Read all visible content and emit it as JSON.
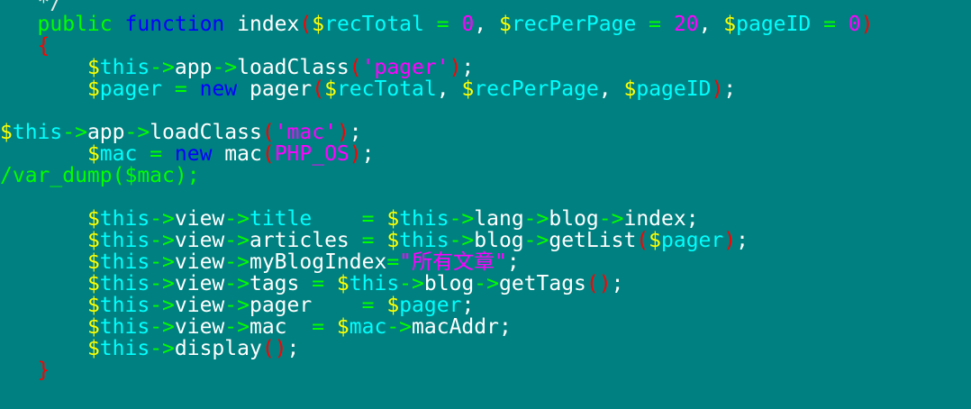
{
  "editor": {
    "background": "#008080",
    "lines": [
      {
        "tokens": [
          {
            "t": "   ",
            "c": "plain"
          },
          {
            "t": "*/",
            "c": "comment"
          }
        ]
      },
      {
        "tokens": [
          {
            "t": "   ",
            "c": "plain"
          },
          {
            "t": "public",
            "c": "keyword"
          },
          {
            "t": " ",
            "c": "plain"
          },
          {
            "t": "function",
            "c": "function"
          },
          {
            "t": " index",
            "c": "ident"
          },
          {
            "t": "(",
            "c": "paren"
          },
          {
            "t": "$",
            "c": "var"
          },
          {
            "t": "recTotal",
            "c": "varname"
          },
          {
            "t": " = ",
            "c": "op"
          },
          {
            "t": "0",
            "c": "number"
          },
          {
            "t": ", ",
            "c": "plain"
          },
          {
            "t": "$",
            "c": "var"
          },
          {
            "t": "recPerPage",
            "c": "varname"
          },
          {
            "t": " = ",
            "c": "op"
          },
          {
            "t": "20",
            "c": "number"
          },
          {
            "t": ", ",
            "c": "plain"
          },
          {
            "t": "$",
            "c": "var"
          },
          {
            "t": "pageID",
            "c": "varname"
          },
          {
            "t": " = ",
            "c": "op"
          },
          {
            "t": "0",
            "c": "number"
          },
          {
            "t": ")",
            "c": "paren"
          }
        ]
      },
      {
        "tokens": [
          {
            "t": "   ",
            "c": "plain"
          },
          {
            "t": "{",
            "c": "brace"
          }
        ]
      },
      {
        "tokens": [
          {
            "t": "       ",
            "c": "plain"
          },
          {
            "t": "$",
            "c": "var"
          },
          {
            "t": "this",
            "c": "varname"
          },
          {
            "t": "->",
            "c": "op"
          },
          {
            "t": "app",
            "c": "ident"
          },
          {
            "t": "->",
            "c": "op"
          },
          {
            "t": "loadClass",
            "c": "ident"
          },
          {
            "t": "(",
            "c": "paren"
          },
          {
            "t": "'pager'",
            "c": "string"
          },
          {
            "t": ")",
            "c": "paren"
          },
          {
            "t": ";",
            "c": "punct"
          }
        ]
      },
      {
        "tokens": [
          {
            "t": "       ",
            "c": "plain"
          },
          {
            "t": "$",
            "c": "var"
          },
          {
            "t": "pager",
            "c": "varname"
          },
          {
            "t": " = ",
            "c": "op"
          },
          {
            "t": "new",
            "c": "new"
          },
          {
            "t": " pager",
            "c": "ident"
          },
          {
            "t": "(",
            "c": "paren"
          },
          {
            "t": "$",
            "c": "var"
          },
          {
            "t": "recTotal",
            "c": "varname"
          },
          {
            "t": ", ",
            "c": "plain"
          },
          {
            "t": "$",
            "c": "var"
          },
          {
            "t": "recPerPage",
            "c": "varname"
          },
          {
            "t": ", ",
            "c": "plain"
          },
          {
            "t": "$",
            "c": "var"
          },
          {
            "t": "pageID",
            "c": "varname"
          },
          {
            "t": ")",
            "c": "paren"
          },
          {
            "t": ";",
            "c": "punct"
          }
        ]
      },
      {
        "tokens": []
      },
      {
        "tokens": [
          {
            "t": "$",
            "c": "var"
          },
          {
            "t": "this",
            "c": "varname"
          },
          {
            "t": "->",
            "c": "op"
          },
          {
            "t": "app",
            "c": "ident"
          },
          {
            "t": "->",
            "c": "op"
          },
          {
            "t": "loadClass",
            "c": "ident"
          },
          {
            "t": "(",
            "c": "paren"
          },
          {
            "t": "'mac'",
            "c": "string"
          },
          {
            "t": ")",
            "c": "paren"
          },
          {
            "t": ";",
            "c": "punct"
          }
        ]
      },
      {
        "tokens": [
          {
            "t": "       ",
            "c": "plain"
          },
          {
            "t": "$",
            "c": "var"
          },
          {
            "t": "mac",
            "c": "varname"
          },
          {
            "t": " = ",
            "c": "op"
          },
          {
            "t": "new",
            "c": "new"
          },
          {
            "t": " mac",
            "c": "ident"
          },
          {
            "t": "(",
            "c": "paren"
          },
          {
            "t": "PHP_OS",
            "c": "const"
          },
          {
            "t": ")",
            "c": "paren"
          },
          {
            "t": ";",
            "c": "punct"
          }
        ]
      },
      {
        "tokens": [
          {
            "t": "/var_dump($mac);",
            "c": "keyword"
          }
        ]
      },
      {
        "tokens": []
      },
      {
        "tokens": [
          {
            "t": "       ",
            "c": "plain"
          },
          {
            "t": "$",
            "c": "var"
          },
          {
            "t": "this",
            "c": "varname"
          },
          {
            "t": "->",
            "c": "op"
          },
          {
            "t": "view",
            "c": "ident"
          },
          {
            "t": "->",
            "c": "op"
          },
          {
            "t": "title",
            "c": "varname"
          },
          {
            "t": "    = ",
            "c": "op"
          },
          {
            "t": "$",
            "c": "var"
          },
          {
            "t": "this",
            "c": "varname"
          },
          {
            "t": "->",
            "c": "op"
          },
          {
            "t": "lang",
            "c": "ident"
          },
          {
            "t": "->",
            "c": "op"
          },
          {
            "t": "blog",
            "c": "ident"
          },
          {
            "t": "->",
            "c": "op"
          },
          {
            "t": "index",
            "c": "ident"
          },
          {
            "t": ";",
            "c": "punct"
          }
        ]
      },
      {
        "tokens": [
          {
            "t": "       ",
            "c": "plain"
          },
          {
            "t": "$",
            "c": "var"
          },
          {
            "t": "this",
            "c": "varname"
          },
          {
            "t": "->",
            "c": "op"
          },
          {
            "t": "view",
            "c": "ident"
          },
          {
            "t": "->",
            "c": "op"
          },
          {
            "t": "articles",
            "c": "ident"
          },
          {
            "t": " = ",
            "c": "op"
          },
          {
            "t": "$",
            "c": "var"
          },
          {
            "t": "this",
            "c": "varname"
          },
          {
            "t": "->",
            "c": "op"
          },
          {
            "t": "blog",
            "c": "ident"
          },
          {
            "t": "->",
            "c": "op"
          },
          {
            "t": "getList",
            "c": "ident"
          },
          {
            "t": "(",
            "c": "paren"
          },
          {
            "t": "$",
            "c": "var"
          },
          {
            "t": "pager",
            "c": "varname"
          },
          {
            "t": ")",
            "c": "paren"
          },
          {
            "t": ";",
            "c": "punct"
          }
        ]
      },
      {
        "tokens": [
          {
            "t": "       ",
            "c": "plain"
          },
          {
            "t": "$",
            "c": "var"
          },
          {
            "t": "this",
            "c": "varname"
          },
          {
            "t": "->",
            "c": "op"
          },
          {
            "t": "view",
            "c": "ident"
          },
          {
            "t": "->",
            "c": "op"
          },
          {
            "t": "myBlogIndex",
            "c": "ident"
          },
          {
            "t": "=",
            "c": "op"
          },
          {
            "t": "\"",
            "c": "string"
          },
          {
            "t": "所有文章",
            "c": "strcn"
          },
          {
            "t": "\"",
            "c": "string"
          },
          {
            "t": ";",
            "c": "punct"
          }
        ]
      },
      {
        "tokens": [
          {
            "t": "       ",
            "c": "plain"
          },
          {
            "t": "$",
            "c": "var"
          },
          {
            "t": "this",
            "c": "varname"
          },
          {
            "t": "->",
            "c": "op"
          },
          {
            "t": "view",
            "c": "ident"
          },
          {
            "t": "->",
            "c": "op"
          },
          {
            "t": "tags",
            "c": "ident"
          },
          {
            "t": " = ",
            "c": "op"
          },
          {
            "t": "$",
            "c": "var"
          },
          {
            "t": "this",
            "c": "varname"
          },
          {
            "t": "->",
            "c": "op"
          },
          {
            "t": "blog",
            "c": "ident"
          },
          {
            "t": "->",
            "c": "op"
          },
          {
            "t": "getTags",
            "c": "ident"
          },
          {
            "t": "()",
            "c": "paren"
          },
          {
            "t": ";",
            "c": "punct"
          }
        ]
      },
      {
        "tokens": [
          {
            "t": "       ",
            "c": "plain"
          },
          {
            "t": "$",
            "c": "var"
          },
          {
            "t": "this",
            "c": "varname"
          },
          {
            "t": "->",
            "c": "op"
          },
          {
            "t": "view",
            "c": "ident"
          },
          {
            "t": "->",
            "c": "op"
          },
          {
            "t": "pager",
            "c": "ident"
          },
          {
            "t": "    = ",
            "c": "op"
          },
          {
            "t": "$",
            "c": "var"
          },
          {
            "t": "pager",
            "c": "varname"
          },
          {
            "t": ";",
            "c": "punct"
          }
        ]
      },
      {
        "tokens": [
          {
            "t": "       ",
            "c": "plain"
          },
          {
            "t": "$",
            "c": "var"
          },
          {
            "t": "this",
            "c": "varname"
          },
          {
            "t": "->",
            "c": "op"
          },
          {
            "t": "view",
            "c": "ident"
          },
          {
            "t": "->",
            "c": "op"
          },
          {
            "t": "mac",
            "c": "ident"
          },
          {
            "t": "  = ",
            "c": "op"
          },
          {
            "t": "$",
            "c": "var"
          },
          {
            "t": "mac",
            "c": "varname"
          },
          {
            "t": "->",
            "c": "op"
          },
          {
            "t": "macAddr",
            "c": "ident"
          },
          {
            "t": ";",
            "c": "punct"
          }
        ]
      },
      {
        "tokens": [
          {
            "t": "       ",
            "c": "plain"
          },
          {
            "t": "$",
            "c": "var"
          },
          {
            "t": "this",
            "c": "varname"
          },
          {
            "t": "->",
            "c": "op"
          },
          {
            "t": "display",
            "c": "ident"
          },
          {
            "t": "()",
            "c": "paren"
          },
          {
            "t": ";",
            "c": "punct"
          }
        ]
      },
      {
        "tokens": [
          {
            "t": "   ",
            "c": "plain"
          },
          {
            "t": "}",
            "c": "brace"
          }
        ]
      }
    ]
  }
}
